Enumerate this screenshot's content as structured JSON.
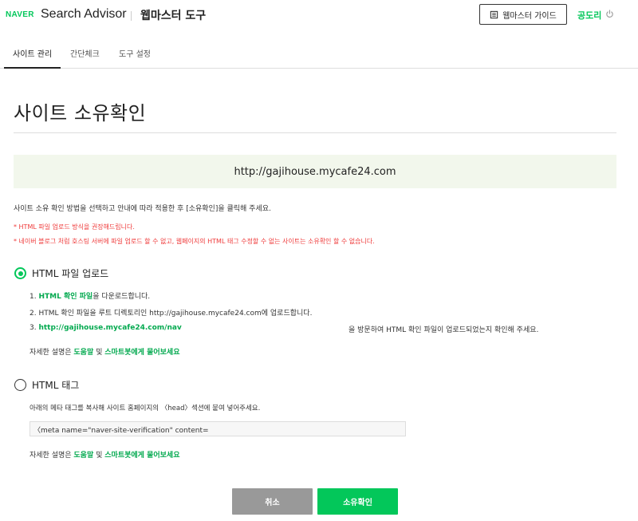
{
  "header": {
    "logo": "NAVER",
    "app_name": "Search Advisor",
    "sub_title": "웹마스터 도구",
    "guide_button": "웹마스터 가이드",
    "user_name": "공도리"
  },
  "tabs": [
    {
      "label": "사이트 관리",
      "active": true
    },
    {
      "label": "간단체크",
      "active": false
    },
    {
      "label": "도구 설정",
      "active": false
    }
  ],
  "page": {
    "title": "사이트 소유확인",
    "site_url": "http://gajihouse.mycafe24.com",
    "description": "사이트 소유 확인 방법을 선택하고 안내에 따라 적용한 후 [소유확인]을 클릭해 주세요.",
    "note1": "* HTML 파일 업로드 방식을 권장해드립니다.",
    "note2": "* 네이버 블로그 처럼 호스팅 서버에 파일 업로드 할 수 없고, 웹페이지의 HTML 태그 수정할 수 없는 사이트는 소유확인 할 수 없습니다."
  },
  "option_file": {
    "label": "HTML 파일 업로드",
    "selected": true,
    "step1_prefix": "1. ",
    "step1_link": "HTML 확인 파일",
    "step1_suffix": "을 다운로드합니다.",
    "step2": "2. HTML 확인 파일을 루트 디렉토리인 http://gajihouse.mycafe24.com에 업로드합니다.",
    "step3_prefix": "3. ",
    "step3_link": "http://gajihouse.mycafe24.com/nav",
    "step3_suffix": "을 방문하여 HTML 확인 파일이 업로드되었는지 확인해 주세요.",
    "help_prefix": "자세한 설명은 ",
    "help_link1": "도움말",
    "help_mid": " 및 ",
    "help_link2": "스마트봇에게 물어보세요"
  },
  "option_tag": {
    "label": "HTML 태그",
    "selected": false,
    "description": "아래의 메타 태그를 복사해 사이트 홈페이지의 〈head〉섹션에 붙여 넣어주세요.",
    "meta_value": "〈meta name=\"naver-site-verification\" content=",
    "help_prefix": "자세한 설명은 ",
    "help_link1": "도움말",
    "help_mid": " 및 ",
    "help_link2": "스마트봇에게 물어보세요"
  },
  "buttons": {
    "cancel": "취소",
    "confirm": "소유확인"
  },
  "colors": {
    "brand_green": "#03c75a",
    "url_box_bg": "#f2f7ec",
    "note_red": "#ef3b3b",
    "cancel_gray": "#999999"
  }
}
